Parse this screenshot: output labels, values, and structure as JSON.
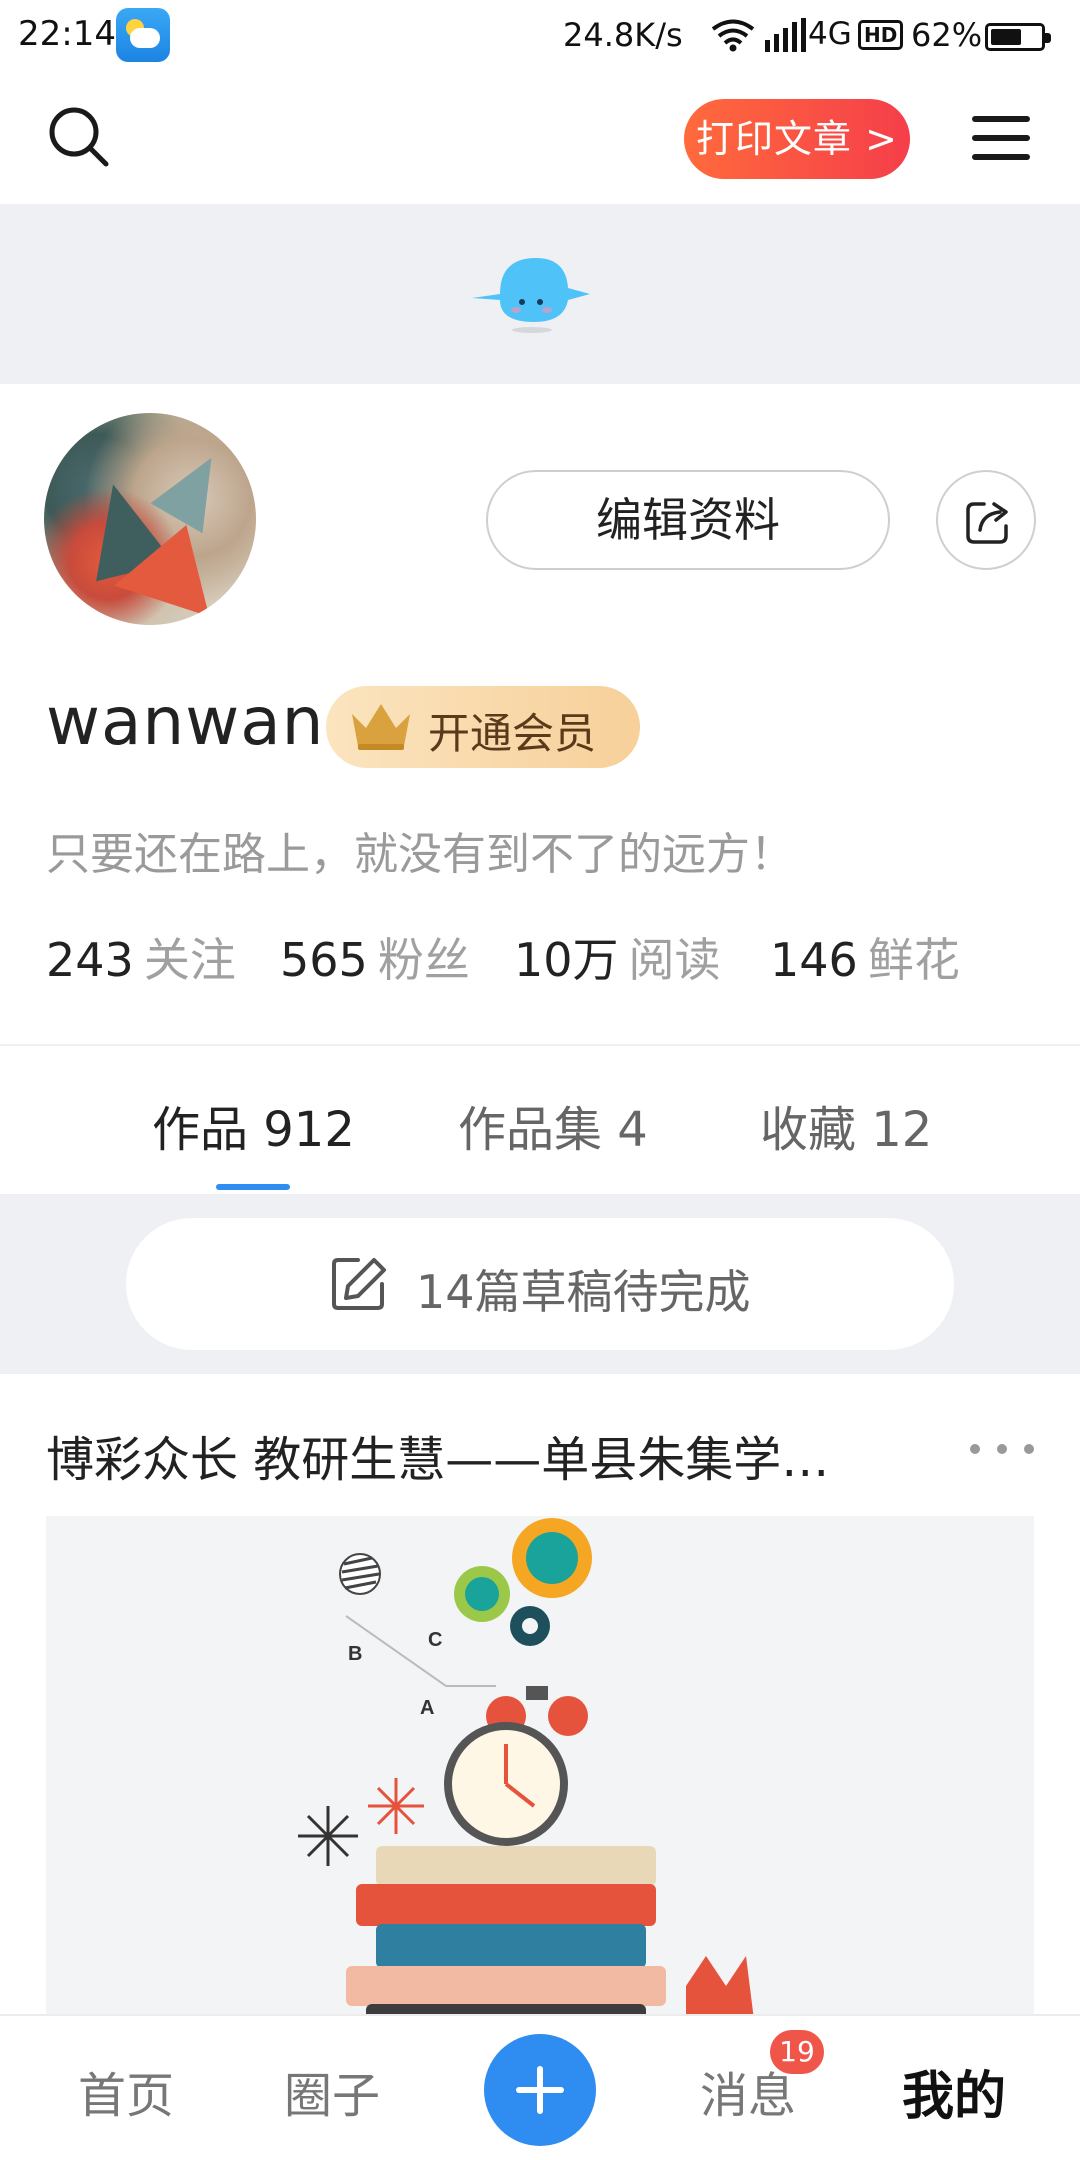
{
  "status_bar": {
    "time": "22:14",
    "net_speed": "24.8K/s",
    "network": "4G",
    "hd": "HD",
    "battery_text": "62%",
    "battery_level": 0.62
  },
  "header": {
    "print_button": "打印文章 >",
    "search_icon": "search-icon",
    "menu_icon": "menu-icon"
  },
  "profile": {
    "username": "wanwan",
    "vip_label": "开通会员",
    "edit_button": "编辑资料",
    "signature": "只要还在路上，就没有到不了的远方！",
    "stats": [
      {
        "num": "243",
        "label": "关注"
      },
      {
        "num": "565",
        "label": "粉丝"
      },
      {
        "num": "10万",
        "label": "阅读"
      },
      {
        "num": "146",
        "label": "鲜花"
      }
    ]
  },
  "tabs": [
    {
      "label": "作品 912",
      "active": true
    },
    {
      "label": "作品集 4",
      "active": false
    },
    {
      "label": "收藏 12",
      "active": false
    }
  ],
  "drafts": {
    "text": "14篇草稿待完成"
  },
  "article": {
    "title": "博彩众长 教研生慧——单县朱集学…",
    "image_labels": [
      "B",
      "C",
      "A"
    ]
  },
  "bottom_nav": {
    "items": [
      {
        "label": "首页"
      },
      {
        "label": "圈子"
      },
      {
        "label": "消息"
      },
      {
        "label": "我的"
      }
    ],
    "message_badge": "19"
  },
  "colors": {
    "accent_blue": "#2f8cf0",
    "print_red": "#f53e4a",
    "vip_gold": "#f7d09a",
    "badge_red": "#f0554a"
  }
}
